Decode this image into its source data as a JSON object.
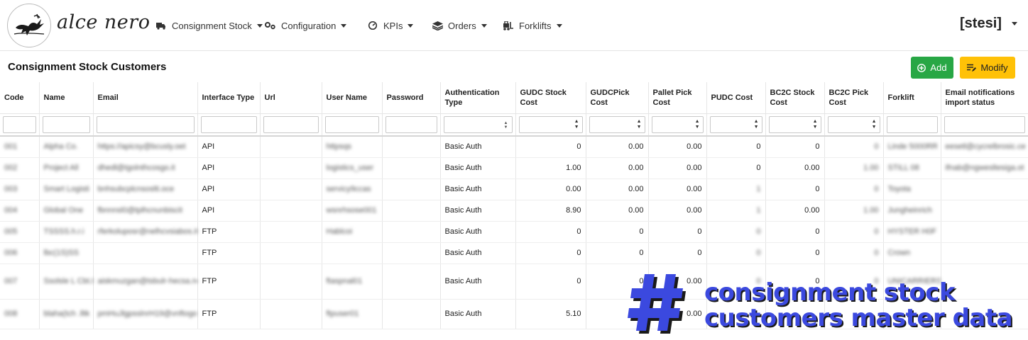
{
  "brand": {
    "name": "alce nero"
  },
  "nav": [
    {
      "label": "Consignment Stock",
      "icon": "truck-icon"
    },
    {
      "label": "Configuration",
      "icon": "cogs-icon"
    },
    {
      "label": "KPIs",
      "icon": "gauge-icon"
    },
    {
      "label": "Orders",
      "icon": "layers-icon"
    },
    {
      "label": "Forklifts",
      "icon": "forklift-icon"
    }
  ],
  "user": {
    "label": "[stesi]"
  },
  "page": {
    "title": "Consignment Stock Customers"
  },
  "actions": {
    "add_label": "Add",
    "modify_label": "Modify"
  },
  "table": {
    "columns": [
      "Code",
      "Name",
      "Email",
      "Interface Type",
      "Url",
      "User Name",
      "Password",
      "Authentication Type",
      "GUDC Stock Cost",
      "GUDCPick Cost",
      "Pallet Pick Cost",
      "PUDC Cost",
      "BC2C Stock Cost",
      "BC2C Pick Cost",
      "Forklift",
      "Email notifications import status"
    ],
    "rows": [
      {
        "code": "001",
        "name": "Alpha Co.",
        "email": "https://apicsy@bcusly.oet",
        "interface": "API",
        "url": "",
        "username": "httpsqs",
        "password": "",
        "auth": "Basic Auth",
        "gudc_stock": "0",
        "gudc_pick": "0.00",
        "pallet_pick": "0.00",
        "pudc": "0",
        "bc2c_stock": "0",
        "bc2c_pick": "0",
        "forklift": "Linde 5000RR",
        "email_status": "eesetl@cycrelbrosic.ce"
      },
      {
        "code": "002",
        "name": "Project All",
        "email": "dhedl@tgolnthcosgo.it",
        "interface": "API",
        "url": "",
        "username": "logistics_user",
        "password": "",
        "auth": "Basic Auth",
        "gudc_stock": "1.00",
        "gudc_pick": "0.00",
        "pallet_pick": "0.00",
        "pudc": "0",
        "bc2c_stock": "0.00",
        "bc2c_pick": "1.00",
        "forklift": "STILL 08",
        "email_status": "ifnab@ngwesltesiga.ot"
      },
      {
        "code": "003",
        "name": "Smart Logisti",
        "email": "bnhsubcplcnsoslti.oce",
        "interface": "API",
        "url": "",
        "username": "servicy9ccas",
        "password": "",
        "auth": "Basic Auth",
        "gudc_stock": "0.00",
        "gudc_pick": "0.00",
        "pallet_pick": "0.00",
        "pudc": "1",
        "bc2c_stock": "0",
        "bc2c_pick": "0",
        "forklift": "Toyota",
        "email_status": ""
      },
      {
        "code": "004",
        "name": "Global One",
        "email": "fbnnnsl0@tplhcnunbiscit",
        "interface": "API",
        "url": "",
        "username": "wsnrhsose001",
        "password": "",
        "auth": "Basic Auth",
        "gudc_stock": "8.90",
        "gudc_pick": "0.00",
        "pallet_pick": "0.00",
        "pudc": "1",
        "bc2c_stock": "0.00",
        "bc2c_pick": "1.00",
        "forklift": "Jungheinrich",
        "email_status": ""
      },
      {
        "code": "005",
        "name": "TSSSS.h.r.i",
        "email": "rferkoluposr@nelhcvsiabos.it",
        "interface": "FTP",
        "url": "",
        "username": "Hablcoi",
        "password": "",
        "auth": "Basic Auth",
        "gudc_stock": "0",
        "gudc_pick": "0",
        "pallet_pick": "0",
        "pudc": "0",
        "bc2c_stock": "0",
        "bc2c_pick": "0",
        "forklift": "HYSTER H0F",
        "email_status": ""
      },
      {
        "code": "006",
        "name": "lbc(1S)SS",
        "email": "",
        "interface": "FTP",
        "url": "",
        "username": "",
        "password": "",
        "auth": "Basic Auth",
        "gudc_stock": "0",
        "gudc_pick": "0",
        "pallet_pick": "0",
        "pudc": "0",
        "bc2c_stock": "0",
        "bc2c_pick": "0",
        "forklift": "Crown",
        "email_status": ""
      },
      {
        "code": "007",
        "name": "Ssolsle L Cbt.F Tecsse Lssisnurle",
        "email": "aiskmuzgan@tsbulr-hecsa.net",
        "interface": "FTP",
        "url": "",
        "username": "ftaspnal01",
        "password": "",
        "auth": "Basic Auth",
        "gudc_stock": "0",
        "gudc_pick": "0",
        "pallet_pick": "0.00",
        "pudc": "0",
        "bc2c_stock": "0",
        "bc2c_pick": "0",
        "forklift": "UNICARRIERS",
        "email_status": ""
      },
      {
        "code": "008",
        "name": "blaha(tch .lltk",
        "email": "pmHuJlgpsslnrH19@vnftogonyuli...",
        "interface": "FTP",
        "url": "",
        "username": "ftpuser01",
        "password": "",
        "auth": "Basic Auth",
        "gudc_stock": "5.10",
        "gudc_pick": "",
        "pallet_pick": "0.00",
        "pudc": "",
        "bc2c_stock": "",
        "bc2c_pick": "",
        "forklift": "",
        "email_status": ""
      }
    ]
  },
  "overlay": {
    "symbol": "#",
    "line1": "consignment stock",
    "line2": "customers master data"
  },
  "colors": {
    "add_button": "#28a745",
    "modify_button": "#ffc107",
    "overlay_text": "#3b49df"
  }
}
